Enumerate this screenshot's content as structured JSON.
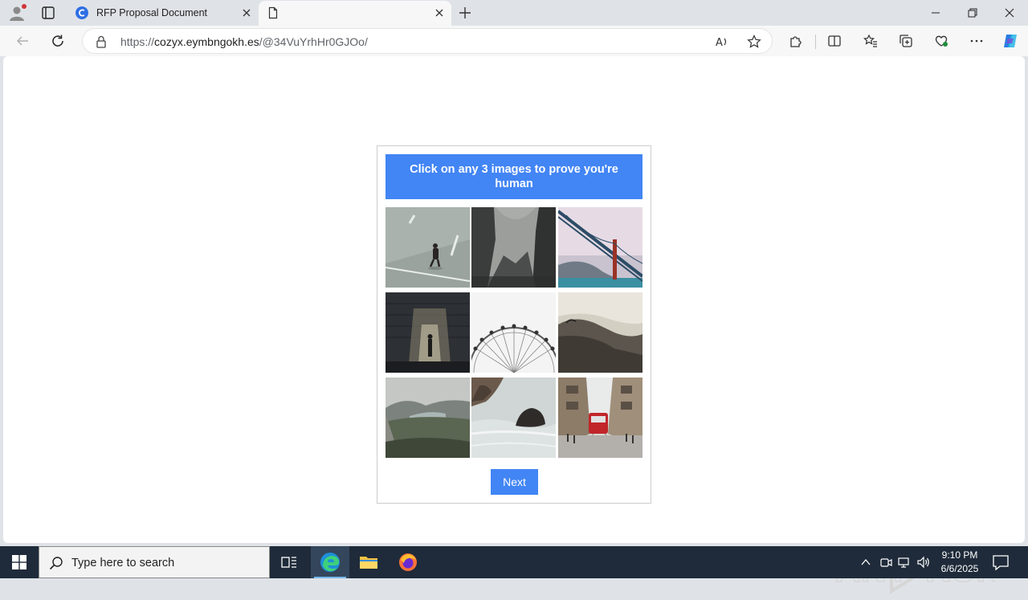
{
  "browser": {
    "tabs": [
      {
        "title": "RFP Proposal Document",
        "active": false
      },
      {
        "title": "",
        "active": true
      }
    ],
    "address": {
      "scheme": "https://",
      "host": "cozyx.eymbngokh.es",
      "path": "/@34VuYrhHr0GJOo/"
    }
  },
  "captcha": {
    "instruction": "Click on any 3 images to prove you're human",
    "images": [
      {
        "name": "person-walking-road"
      },
      {
        "name": "misty-mountains"
      },
      {
        "name": "suspension-bridge"
      },
      {
        "name": "person-by-stone-wall"
      },
      {
        "name": "ferris-wheel"
      },
      {
        "name": "rocky-coast-clouds"
      },
      {
        "name": "green-valley"
      },
      {
        "name": "sea-rock-waves"
      },
      {
        "name": "red-tram-street"
      }
    ],
    "next_label": "Next",
    "accent_color": "#4285f4"
  },
  "watermark": {
    "text": "ANY RUN"
  },
  "taskbar": {
    "search_placeholder": "Type here to search",
    "time": "9:10 PM",
    "date": "6/6/2025"
  }
}
